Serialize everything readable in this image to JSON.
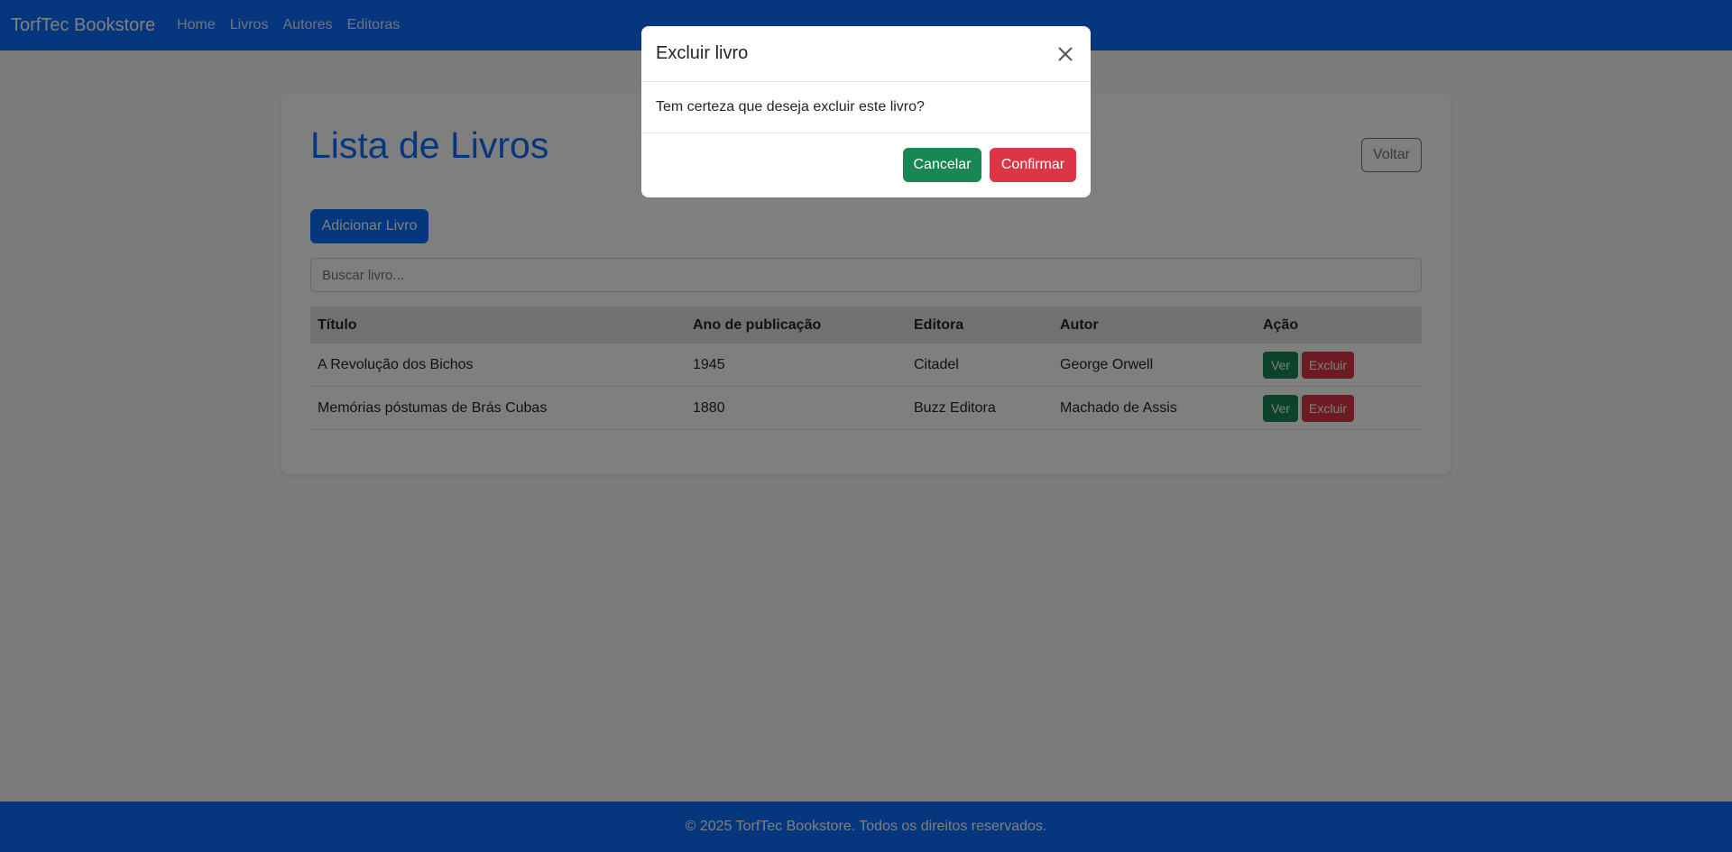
{
  "navbar": {
    "brand": "TorfTec Bookstore",
    "links": [
      "Home",
      "Livros",
      "Autores",
      "Editoras"
    ]
  },
  "main": {
    "title": "Lista de Livros",
    "back_label": "Voltar",
    "add_label": "Adicionar Livro",
    "search": {
      "placeholder": "Buscar livro...",
      "value": ""
    },
    "table": {
      "headers": [
        "Título",
        "Ano de publicação",
        "Editora",
        "Autor",
        "Ação"
      ],
      "rows": [
        {
          "titulo": "A Revolução dos Bichos",
          "ano": "1945",
          "editora": "Citadel",
          "autor": "George Orwell",
          "ver": "Ver",
          "excluir": "Excluir"
        },
        {
          "titulo": "Memórias póstumas de Brás Cubas",
          "ano": "1880",
          "editora": "Buzz Editora",
          "autor": "Machado de Assis",
          "ver": "Ver",
          "excluir": "Excluir"
        }
      ]
    }
  },
  "footer": {
    "text": "© 2025 TorfTec Bookstore. Todos os direitos reservados."
  },
  "modal": {
    "title": "Excluir livro",
    "message": "Tem certeza que deseja excluir este livro?",
    "cancel_label": "Cancelar",
    "confirm_label": "Confirmar",
    "close_icon": "close-icon"
  },
  "colors": {
    "primary": "#0d6efd",
    "success": "#198754",
    "danger": "#dc3545",
    "secondary": "#6c757d"
  }
}
